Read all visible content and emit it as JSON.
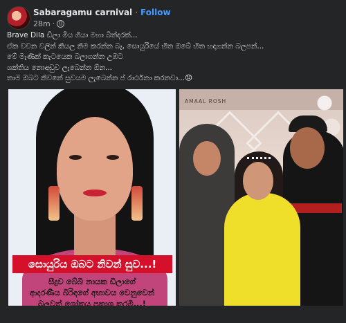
{
  "post": {
    "page_name": "Sabaragamu carnival",
    "separator": "·",
    "follow_label": "Follow",
    "time": "28m",
    "privacy_icon": "globe-icon",
    "text_lines": [
      "Brave Dila  ඩිලා මිය ගියා මහා බිත්දරක්...",
      "ඒක වචන වලින් කියල නිම කරන්න බෑ, සොයුරියේ හිත ඔබේ හිත හදාගන්න බලපන්...",
      "මේ මැණික් කැටයෙක බලාගන්න උඹට",
      "ශක්තිය නොඅඩුව ලැබෙන්න ඕන...",
      "තාම ඔබට නිවනේ සුවයම ලැබෙන්න ප් රාර්ථනා කරනවා...😞"
    ]
  },
  "left_image": {
    "headline": "සොයුරිය ඔබට නිවන් සුව...!",
    "sub_lines": [
      "සීදුව බේබි නායක ඩිලාගේ",
      "ආදරණීය බිරිඳගේ අභාවය වෙනුවෙන්",
      "බලවත් ශෝකය පකාශ කරමි...!"
    ]
  },
  "right_image": {
    "banner_text": "AMAAL ROSH"
  }
}
